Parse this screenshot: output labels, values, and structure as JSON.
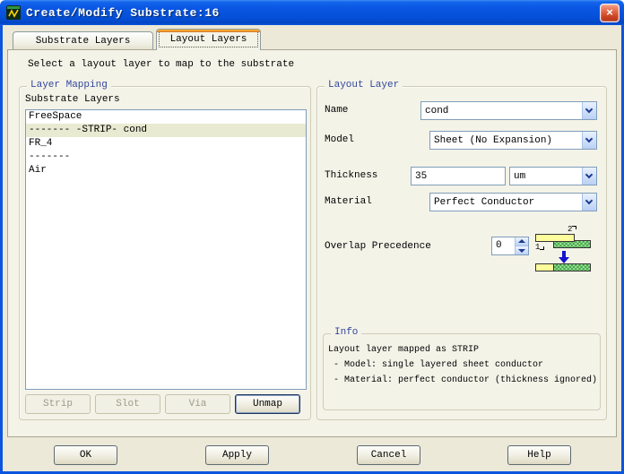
{
  "window": {
    "title": "Create/Modify Substrate:16",
    "close_label": "×"
  },
  "tabs": [
    {
      "label": "Substrate Layers"
    },
    {
      "label": "Layout Layers"
    }
  ],
  "intro_text": "Select a layout layer to map to the substrate",
  "layer_mapping": {
    "group_label": "Layer Mapping",
    "list_label": "Substrate Layers",
    "items": [
      {
        "label": "FreeSpace"
      },
      {
        "label": "------- -STRIP- cond"
      },
      {
        "label": "FR_4"
      },
      {
        "label": "-------"
      },
      {
        "label": "Air"
      }
    ],
    "buttons": {
      "strip": "Strip",
      "slot": "Slot",
      "via": "Via",
      "unmap": "Unmap"
    }
  },
  "layout_layer": {
    "group_label": "Layout Layer",
    "name_label": "Name",
    "name_value": "cond",
    "model_label": "Model",
    "model_value": "Sheet (No Expansion)",
    "thickness_label": "Thickness",
    "thickness_value": "35",
    "thickness_unit": "um",
    "material_label": "Material",
    "material_value": "Perfect Conductor",
    "overlap_label": "Overlap Precedence",
    "overlap_value": "0",
    "precedence_diagram": {
      "layer1_label": "1",
      "layer2_label": "2"
    }
  },
  "info": {
    "group_label": "Info",
    "lines": [
      "Layout layer mapped as STRIP",
      " - Model: single layered sheet conductor",
      " - Material: perfect conductor (thickness ignored)"
    ]
  },
  "dialog_buttons": {
    "ok": "OK",
    "apply": "Apply",
    "cancel": "Cancel",
    "help": "Help"
  },
  "colors": {
    "titlebar_blue": "#0a57e4",
    "selection_bg": "#e9ead2",
    "group_label_blue": "#33479e",
    "input_border": "#7f9db9",
    "active_tab_accent": "#e68b2c"
  }
}
